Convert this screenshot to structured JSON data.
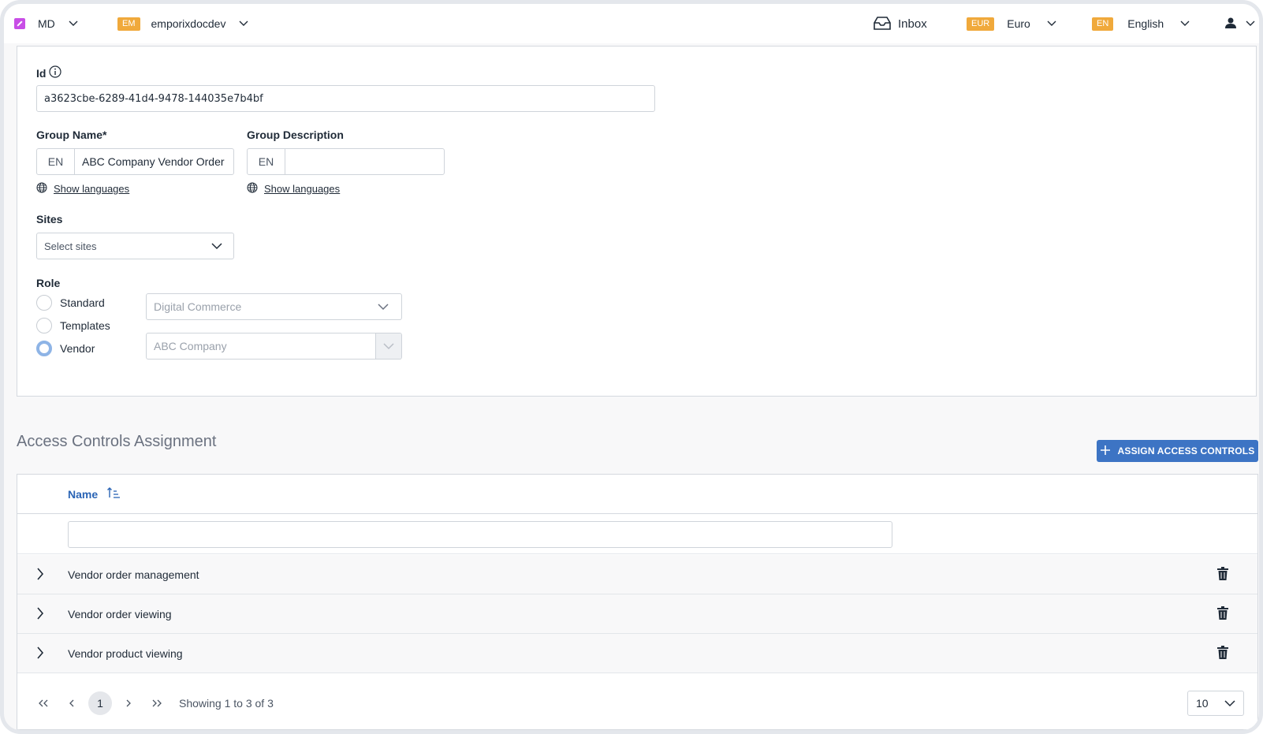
{
  "topbar": {
    "tenant_label": "MD",
    "project_badge": "EM",
    "project_name": "emporixdocdev",
    "inbox_label": "Inbox",
    "currency_badge": "EUR",
    "currency_label": "Euro",
    "language_badge": "EN",
    "language_label": "English"
  },
  "form": {
    "id_label": "Id",
    "id_value": "a3623cbe-6289-41d4-9478-144035e7b4bf",
    "group_name_label": "Group Name*",
    "group_name_lang": "EN",
    "group_name_value": "ABC Company Vendor Order",
    "group_description_label": "Group Description",
    "group_description_lang": "EN",
    "group_description_value": "",
    "show_languages_label": "Show languages",
    "sites_label": "Sites",
    "sites_placeholder": "Select sites",
    "role_label": "Role",
    "roles": [
      {
        "label": "Standard",
        "selected": false
      },
      {
        "label": "Templates",
        "selected": false
      },
      {
        "label": "Vendor",
        "selected": true
      }
    ],
    "standard_select_value": "Digital Commerce",
    "vendor_select_value": "ABC Company"
  },
  "access_controls": {
    "title": "Access Controls Assignment",
    "assign_button_label": "ASSIGN ACCESS CONTROLS",
    "column_name": "Name",
    "rows": [
      {
        "name": "Vendor order management"
      },
      {
        "name": "Vendor order viewing"
      },
      {
        "name": "Vendor product viewing"
      }
    ],
    "pager": {
      "current_page": "1",
      "info": "Showing 1 to 3 of 3",
      "page_size": "10"
    }
  },
  "colors": {
    "accent": "#3d74c4",
    "badge": "#f0a93b",
    "header_link": "#2a64b5"
  }
}
